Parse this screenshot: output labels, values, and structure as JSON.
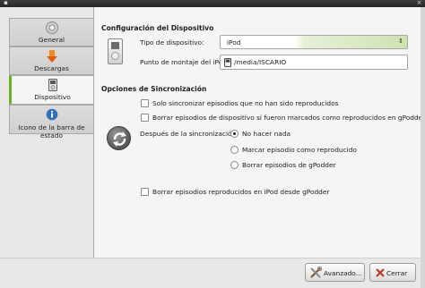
{
  "sidebar": {
    "tabs": [
      {
        "label": "General",
        "icon": "gear-icon"
      },
      {
        "label": "Descargas",
        "icon": "download-arrow-icon"
      },
      {
        "label": "Dispositivo",
        "icon": "ipod-icon",
        "active": true
      },
      {
        "label": "Icono de la barra de estado",
        "icon": "info-icon"
      }
    ]
  },
  "device": {
    "section_title": "Configuración del Dispositivo",
    "type_label": "Tipo de dispositivo:",
    "type_value": "iPod",
    "mount_label": "Punto de montaje del iPod:",
    "mount_value": "/media/ISCARIO"
  },
  "sync": {
    "section_title": "Opciones de Sincronización",
    "only_unplayed": "Solo sincronizar episodios que no han sido reproducidos",
    "delete_marked": "Borrar episodios de dispositivo si fueron marcados como reproducidos en gPodder",
    "after_sync_label": "Después de la sincronización:",
    "radio_options": [
      {
        "label": "No hacer nada",
        "checked": true
      },
      {
        "label": "Marcar episodio como reproducido",
        "checked": false
      },
      {
        "label": "Borrar episodios de gPodder",
        "checked": false
      }
    ],
    "delete_played_ipod": "Borrar episodios reproducidos en iPod desde gPodder"
  },
  "buttons": {
    "advanced": "Avanzado...",
    "close": "Cerrar"
  },
  "colors": {
    "active_tab_accent": "#6fae2a",
    "titlebar": "#2b2b2b",
    "close_icon": "#c0392b"
  }
}
